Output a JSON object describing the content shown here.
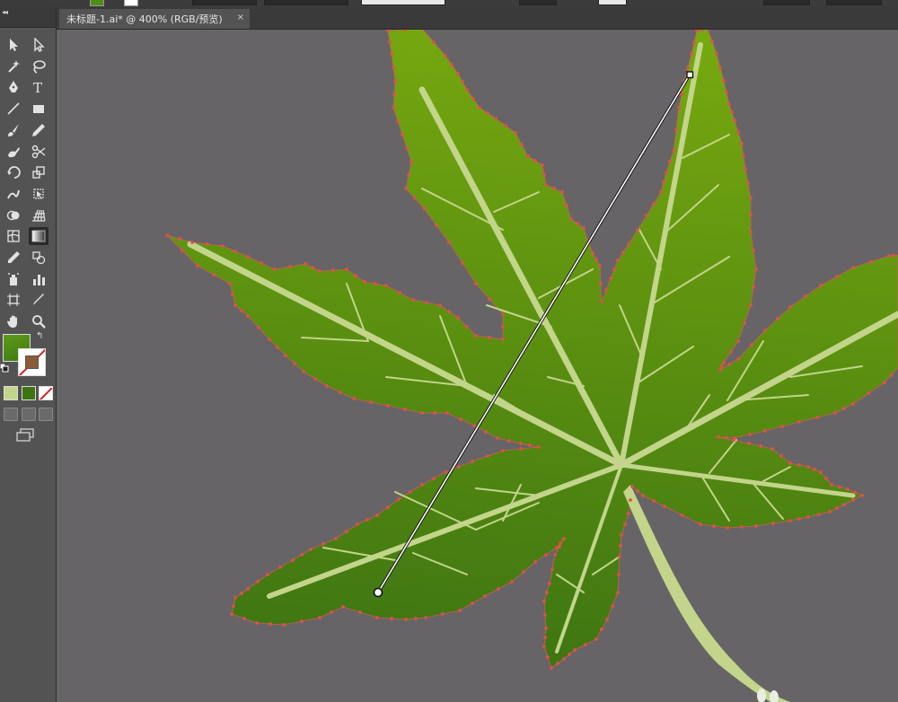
{
  "document": {
    "tab_title": "未标题-1.ai* @ 400% (RGB/预览)",
    "close_glyph": "×"
  },
  "toolbar": {
    "collapse_glyph": "◂◂",
    "tools": [
      {
        "name": "selection-tool-icon"
      },
      {
        "name": "direct-selection-tool-icon"
      },
      {
        "name": "magic-wand-tool-icon"
      },
      {
        "name": "lasso-tool-icon"
      },
      {
        "name": "pen-tool-icon"
      },
      {
        "name": "type-tool-icon"
      },
      {
        "name": "line-tool-icon"
      },
      {
        "name": "rectangle-tool-icon"
      },
      {
        "name": "paintbrush-tool-icon"
      },
      {
        "name": "pencil-tool-icon"
      },
      {
        "name": "blob-brush-tool-icon"
      },
      {
        "name": "scissors-tool-icon"
      },
      {
        "name": "rotate-tool-icon"
      },
      {
        "name": "scale-tool-icon"
      },
      {
        "name": "warp-tool-icon"
      },
      {
        "name": "free-transform-tool-icon"
      },
      {
        "name": "shape-builder-tool-icon"
      },
      {
        "name": "perspective-grid-tool-icon"
      },
      {
        "name": "mesh-tool-icon"
      },
      {
        "name": "gradient-tool-icon"
      },
      {
        "name": "eyedropper-tool-icon"
      },
      {
        "name": "blend-tool-icon"
      },
      {
        "name": "symbol-sprayer-tool-icon"
      },
      {
        "name": "column-graph-tool-icon"
      },
      {
        "name": "artboard-tool-icon"
      },
      {
        "name": "slice-tool-icon"
      },
      {
        "name": "hand-tool-icon"
      },
      {
        "name": "zoom-tool-icon"
      }
    ],
    "type_tool_glyph": "T",
    "swap_glyph": "↰"
  },
  "colors": {
    "canvas_bg": "#676467",
    "leaf_light": "#76a80f",
    "leaf_dark": "#3e7512",
    "vein": "#c2d58a",
    "anchor_point": "#e0504a",
    "fill_swatch": "#4f8e17"
  }
}
